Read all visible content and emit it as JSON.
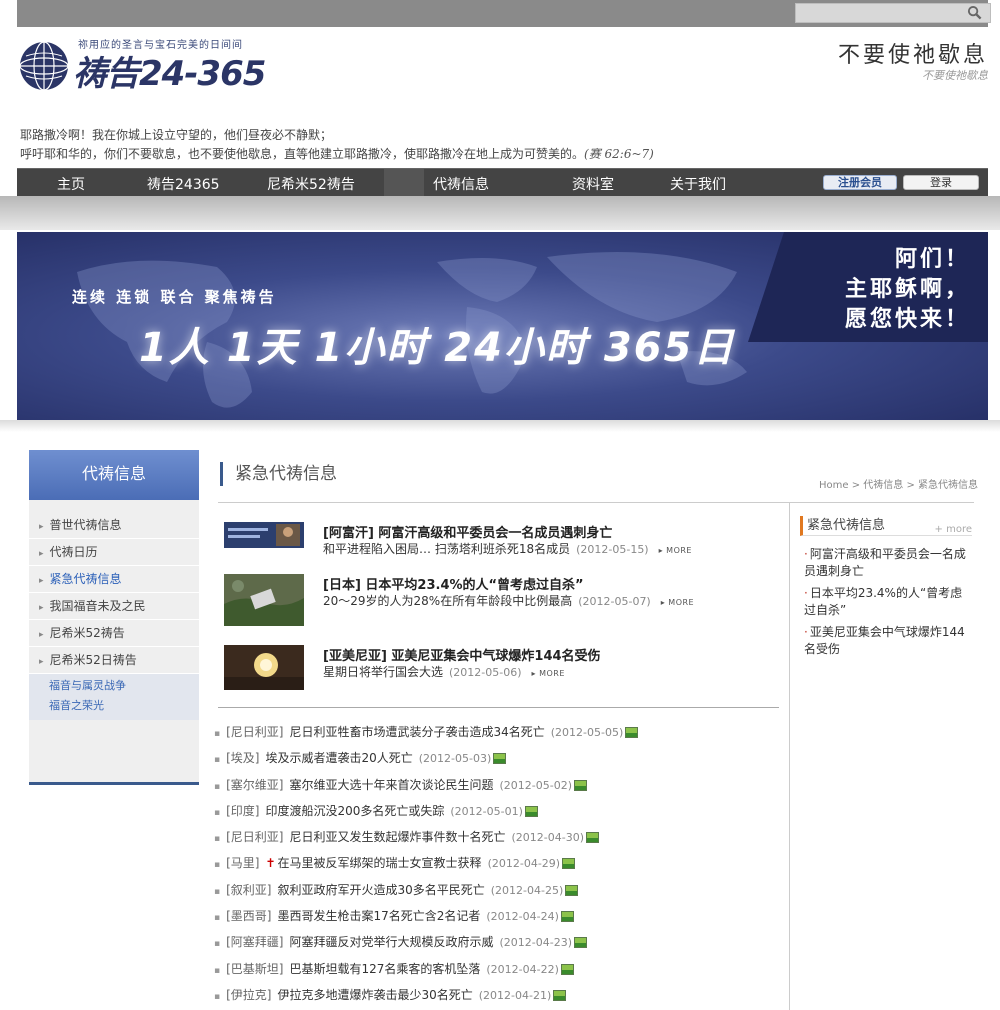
{
  "header": {
    "logo_tagline": "祢用应的圣言与宝石完美的日间间",
    "logo_title": "祷告24-365",
    "motto_calligraphy": "不要使祂歇息",
    "motto_sub": "不要使祂歇息",
    "verse_line1": "耶路撒冷啊！我在你城上设立守望的，他们昼夜必不静默；",
    "verse_line2": "呼吁耶和华的，你们不要歇息，也不要使他歇息，直等他建立耶路撒冷，使耶路撒冷在地上成为可赞美的。",
    "verse_ref": "(赛 62:6~7)"
  },
  "nav": {
    "items": [
      "主页",
      "祷告24365",
      "尼希米52祷告",
      "代祷信息",
      "资料室",
      "关于我们"
    ],
    "join": "注册会员",
    "login": "登录"
  },
  "banner": {
    "slogan": "连续 连锁 联合 聚焦祷告",
    "headline": "1人 1天 1小时 24小时 365日",
    "amen_line1": "阿们！",
    "amen_line2": "主耶稣啊，",
    "amen_line3": "愿您快来！"
  },
  "sidebar": {
    "title": "代祷信息",
    "items": [
      "普世代祷信息",
      "代祷日历",
      "紧急代祷信息",
      "我国福音未及之民",
      "尼希米52祷告",
      "尼希米52日祷告"
    ],
    "sub_items": [
      "福音与属灵战争",
      "福音之荣光"
    ]
  },
  "main": {
    "title": "紧急代祷信息",
    "breadcrumb": "Home > 代祷信息 > 紧急代祷信息",
    "features": [
      {
        "title": "[阿富汗] 阿富汗高级和平委员会一名成员遇刺身亡",
        "summary": "和平进程陷入困局… 扫荡塔利班杀死18名成员",
        "date": "(2012-05-15)",
        "more": "▸ MORE"
      },
      {
        "title": "[日本] 日本平均23.4%的人“曾考虑过自杀”",
        "summary": "20～29岁的人为28%在所有年龄段中比例最高",
        "date": "(2012-05-07)",
        "more": "▸ MORE"
      },
      {
        "title": "[亚美尼亚] 亚美尼亚集会中气球爆炸144名受伤",
        "summary": "星期日将举行国会大选",
        "date": "(2012-05-06)",
        "more": "▸ MORE"
      }
    ],
    "news": [
      {
        "region": "[尼日利亚]",
        "title": "尼日利亚牲畜市场遭武装分子袭击造成34名死亡",
        "date": "(2012-05-05)",
        "cross": false
      },
      {
        "region": "[埃及]",
        "title": "埃及示威者遭袭击20人死亡",
        "date": "(2012-05-03)",
        "cross": false
      },
      {
        "region": "[塞尔维亚]",
        "title": "塞尔维亚大选十年来首次谈论民生问题",
        "date": "(2012-05-02)",
        "cross": false
      },
      {
        "region": "[印度]",
        "title": "印度渡船沉没200多名死亡或失踪",
        "date": "(2012-05-01)",
        "cross": false
      },
      {
        "region": "[尼日利亚]",
        "title": "尼日利亚又发生数起爆炸事件数十名死亡",
        "date": "(2012-04-30)",
        "cross": false
      },
      {
        "region": "[马里]",
        "title": "在马里被反军绑架的瑞士女宣教士获释",
        "date": "(2012-04-29)",
        "cross": true
      },
      {
        "region": "[叙利亚]",
        "title": "叙利亚政府军开火造成30多名平民死亡",
        "date": "(2012-04-25)",
        "cross": false
      },
      {
        "region": "[墨西哥]",
        "title": "墨西哥发生枪击案17名死亡含2名记者",
        "date": "(2012-04-24)",
        "cross": false
      },
      {
        "region": "[阿塞拜疆]",
        "title": "阿塞拜疆反对党举行大规模反政府示威",
        "date": "(2012-04-23)",
        "cross": false
      },
      {
        "region": "[巴基斯坦]",
        "title": "巴基斯坦载有127名乘客的客机坠落",
        "date": "(2012-04-22)",
        "cross": false
      },
      {
        "region": "[伊拉克]",
        "title": "伊拉克多地遭爆炸袭击最少30名死亡",
        "date": "(2012-04-21)",
        "cross": false
      }
    ]
  },
  "urgent": {
    "title": "紧急代祷信息",
    "more": "+ more",
    "items": [
      "阿富汗高级和平委员会一名成员遇刺身亡",
      "日本平均23.4%的人“曾考虑过自杀”",
      "亚美尼亚集会中气球爆炸144名受伤"
    ]
  }
}
